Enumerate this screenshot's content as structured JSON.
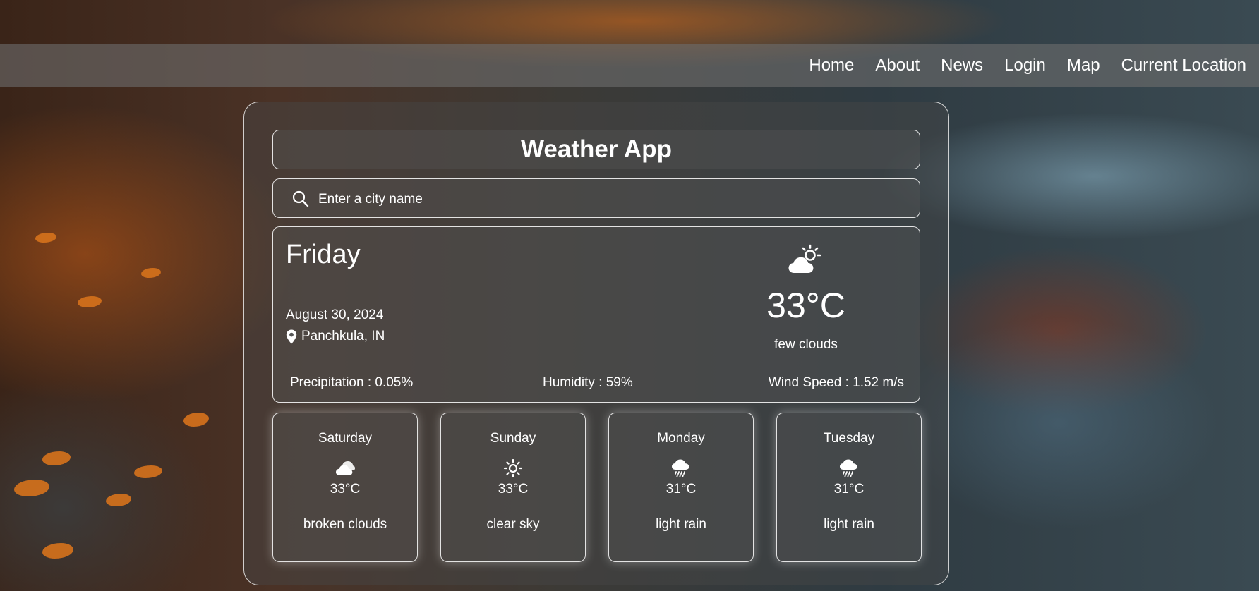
{
  "nav": {
    "items": [
      "Home",
      "About",
      "News",
      "Login",
      "Map",
      "Current Location"
    ]
  },
  "app": {
    "title": "Weather App",
    "search_placeholder": "Enter a city name"
  },
  "current": {
    "day": "Friday",
    "date": "August 30, 2024",
    "location": "Panchkula, IN",
    "temperature": "33°C",
    "description": "few clouds",
    "icon": "partly-cloudy-icon",
    "precipitation": "Precipitation : 0.05%",
    "humidity": "Humidity : 59%",
    "wind": "Wind Speed : 1.52 m/s"
  },
  "forecast": [
    {
      "day": "Saturday",
      "temperature": "33°C",
      "description": "broken clouds",
      "icon": "clouds-icon"
    },
    {
      "day": "Sunday",
      "temperature": "33°C",
      "description": "clear sky",
      "icon": "sun-icon"
    },
    {
      "day": "Monday",
      "temperature": "31°C",
      "description": "light rain",
      "icon": "rain-icon"
    },
    {
      "day": "Tuesday",
      "temperature": "31°C",
      "description": "light rain",
      "icon": "rain-icon"
    }
  ]
}
